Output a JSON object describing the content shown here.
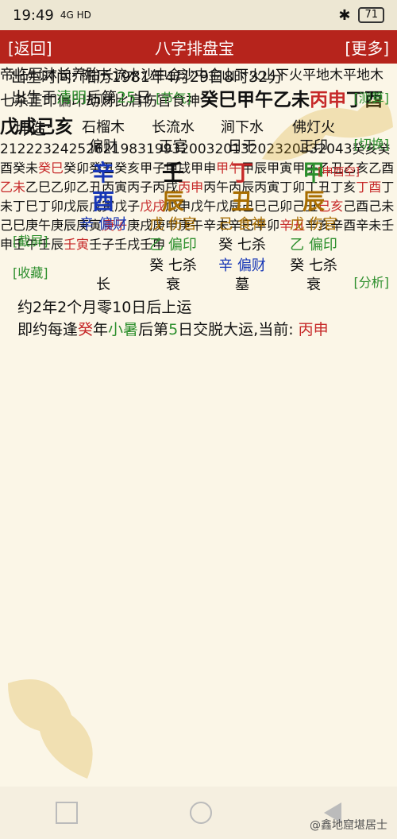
{
  "status": {
    "time": "19:49",
    "signal": "4G HD",
    "battery": "71"
  },
  "header": {
    "back": "[返回]",
    "title": "八字排盘宝",
    "more": "[更多]"
  },
  "birth": {
    "line1": "出生时间: 阳历1981年4月29日8时32分",
    "line2_prefix": "出生于",
    "line2_term": "清明",
    "line2_mid": "后第",
    "line2_num": "25",
    "line2_suffix": "日",
    "jieqi": "[节气]",
    "ceshu": "[测算]"
  },
  "pillars": {
    "label": "坤造:",
    "nayin": [
      "石榴木",
      "长流水",
      "涧下水",
      "佛灯火"
    ],
    "shishen": [
      "偏财",
      "正官",
      "日干",
      "正印"
    ],
    "gan": [
      "辛",
      "壬",
      "丁",
      "甲"
    ],
    "zhi": [
      "酉",
      "辰",
      "丑",
      "辰"
    ],
    "hide1": [
      "辛 偏财",
      "戊 伤官",
      "己 食神",
      "戊 伤官"
    ],
    "hide2": [
      "",
      "乙 偏印",
      "癸 七杀",
      "乙 偏印"
    ],
    "hide3": [
      "",
      "癸 七杀",
      "辛 偏财",
      "癸 七杀"
    ],
    "state": [
      "长",
      "衰",
      "墓",
      "衰"
    ],
    "kong": "[申酉空]",
    "switch": "[切换]",
    "screenshot": "[截屏]",
    "collect": "[收藏]",
    "analyze": "[分析]"
  },
  "luck": {
    "line1": "约2年2个月零10日后上运",
    "line2_prefix": "即约每逢",
    "line2_gan": "癸",
    "line2_mid": "年",
    "line2_term": "小暑",
    "line2_mid2": "后第",
    "line2_num": "5",
    "line2_suffix": "日交脱大运,当前: ",
    "line2_current": "丙申"
  },
  "dayun": {
    "state": [
      "帝",
      "临",
      "冠",
      "沐",
      "长",
      "养",
      "胎"
    ],
    "nayin": [
      "长流水",
      "沙中金",
      "沙中金",
      "山下火",
      "山下火",
      "平地木",
      "平地木"
    ],
    "shishen": [
      "七杀",
      "正印",
      "偏印",
      "劫财",
      "比肩",
      "伤官",
      "食神"
    ],
    "ganzhi": [
      "癸巳",
      "甲午",
      "乙未",
      "丙申",
      "丁酉",
      "戊戌",
      "己亥"
    ],
    "age": [
      "2",
      "12",
      "22",
      "32",
      "42",
      "52",
      "62"
    ],
    "year": [
      "1983",
      "1993",
      "2003",
      "2013",
      "2023",
      "2033",
      "2043"
    ],
    "liunian": [
      [
        "癸亥",
        "癸酉",
        "癸未",
        "癸巳",
        "癸卯",
        "癸丑",
        "癸亥"
      ],
      [
        "甲子",
        "甲戌",
        "甲申",
        "甲午",
        "甲辰",
        "甲寅",
        "甲子"
      ],
      [
        "乙丑",
        "乙亥",
        "乙酉",
        "乙未",
        "乙巳",
        "乙卯",
        "乙丑"
      ],
      [
        "丙寅",
        "丙子",
        "丙戌",
        "丙申",
        "丙午",
        "丙辰",
        "丙寅"
      ],
      [
        "丁卯",
        "丁丑",
        "丁亥",
        "丁酉",
        "丁未",
        "丁巳",
        "丁卯"
      ],
      [
        "戊辰",
        "戊寅",
        "戊子",
        "戊戌",
        "戊申",
        "戊午",
        "戊辰"
      ],
      [
        "己巳",
        "己卯",
        "己丑",
        "己亥",
        "己酉",
        "己未",
        "己巳"
      ],
      [
        "庚午",
        "庚辰",
        "庚寅",
        "庚子",
        "庚戌",
        "庚申",
        "庚午"
      ],
      [
        "辛未",
        "辛巳",
        "辛卯",
        "辛丑",
        "辛亥",
        "辛酉",
        "辛未"
      ],
      [
        "壬申",
        "壬午",
        "壬辰",
        "壬寅",
        "壬子",
        "壬戌",
        "壬申"
      ]
    ],
    "current_index": 3
  },
  "watermark": "@鑫地窟堪居士",
  "colors": {
    "header": "#b6241c",
    "accent_green": "#2d8f2d",
    "red": "#c62828",
    "blue": "#1636b6",
    "brown": "#a86d00"
  }
}
